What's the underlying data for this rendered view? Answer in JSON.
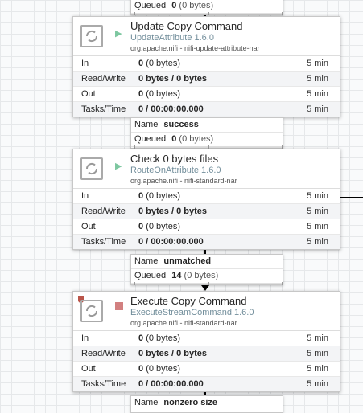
{
  "top_conn": {
    "queued_label": "Queued",
    "queued_count": "0",
    "queued_size": "(0 bytes)"
  },
  "processors": [
    {
      "name": "Update Copy Command",
      "type": "UpdateAttribute 1.6.0",
      "bundle": "org.apache.nifi - nifi-update-attribute-nar",
      "status": "running",
      "stats": [
        {
          "label": "In",
          "value": "0",
          "extra": "(0 bytes)",
          "time": "5 min"
        },
        {
          "label": "Read/Write",
          "value": "0 bytes / 0 bytes",
          "extra": "",
          "time": "5 min"
        },
        {
          "label": "Out",
          "value": "0",
          "extra": "(0 bytes)",
          "time": "5 min"
        },
        {
          "label": "Tasks/Time",
          "value": "0 / 00:00:00.000",
          "extra": "",
          "time": "5 min"
        }
      ]
    },
    {
      "name": "Check 0 bytes files",
      "type": "RouteOnAttribute 1.6.0",
      "bundle": "org.apache.nifi - nifi-standard-nar",
      "status": "running",
      "stats": [
        {
          "label": "In",
          "value": "0",
          "extra": "(0 bytes)",
          "time": "5 min"
        },
        {
          "label": "Read/Write",
          "value": "0 bytes / 0 bytes",
          "extra": "",
          "time": "5 min"
        },
        {
          "label": "Out",
          "value": "0",
          "extra": "(0 bytes)",
          "time": "5 min"
        },
        {
          "label": "Tasks/Time",
          "value": "0 / 00:00:00.000",
          "extra": "",
          "time": "5 min"
        }
      ]
    },
    {
      "name": "Execute Copy Command",
      "type": "ExecuteStreamCommand 1.6.0",
      "bundle": "org.apache.nifi - nifi-standard-nar",
      "status": "stopped",
      "stats": [
        {
          "label": "In",
          "value": "0",
          "extra": "(0 bytes)",
          "time": "5 min"
        },
        {
          "label": "Read/Write",
          "value": "0 bytes / 0 bytes",
          "extra": "",
          "time": "5 min"
        },
        {
          "label": "Out",
          "value": "0",
          "extra": "(0 bytes)",
          "time": "5 min"
        },
        {
          "label": "Tasks/Time",
          "value": "0 / 00:00:00.000",
          "extra": "",
          "time": "5 min"
        }
      ]
    }
  ],
  "connections": [
    {
      "name_label": "Name",
      "name": "success",
      "queued_label": "Queued",
      "queued_count": "0",
      "queued_size": "(0 bytes)"
    },
    {
      "name_label": "Name",
      "name": "unmatched",
      "queued_label": "Queued",
      "queued_count": "14",
      "queued_size": "(0 bytes)"
    }
  ],
  "bottom_conn": {
    "name_label": "Name",
    "name": "nonzero size"
  },
  "colors": {
    "running": "#7dc7a0",
    "stopped": "#d28080",
    "type_text": "#728e9b",
    "invalid": "#ba554a"
  }
}
